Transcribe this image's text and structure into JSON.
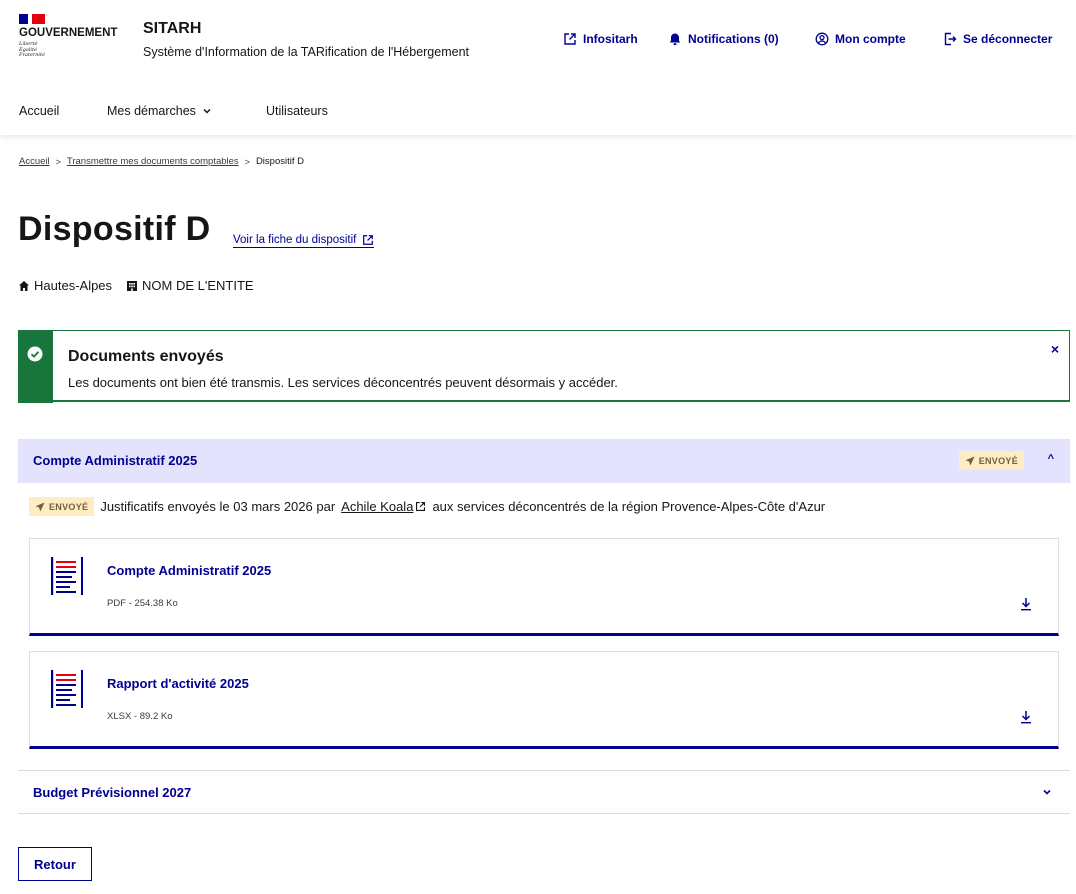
{
  "header": {
    "gov_title": "GOUVERNEMENT",
    "devise": [
      "Liberté",
      "Égalité",
      "Fraternité"
    ],
    "app_name": "SITARH",
    "app_subtitle": "Système d'Information de la TARification de l'Hébergement",
    "links": {
      "infositarh": "Infositarh",
      "notifications": "Notifications (0)",
      "account": "Mon compte",
      "logout": "Se déconnecter"
    }
  },
  "nav": {
    "home": "Accueil",
    "demarches": "Mes démarches",
    "users": "Utilisateurs"
  },
  "breadcrumb": {
    "home": "Accueil",
    "parent": "Transmettre mes documents comptables",
    "current": "Dispositif D"
  },
  "page": {
    "title": "Dispositif D",
    "fiche_link": "Voir la fiche du dispositif",
    "department": "Hautes-Alpes",
    "entity": "NOM DE L'ENTITE"
  },
  "alert": {
    "title": "Documents envoyés",
    "text": "Les documents ont bien été transmis. Les services déconcentrés peuvent désormais y accéder.",
    "close": "×"
  },
  "accordion_open": {
    "title": "Compte Administratif 2025",
    "badge": "ENVOYÉ",
    "chevron": "^",
    "sent_badge": "ENVOYÉ",
    "sent_prefix": "Justificatifs envoyés le 03 mars 2026 par",
    "sent_user": "Achile Koala",
    "sent_suffix": "aux services déconcentrés de la région Provence-Alpes-Côte d'Azur",
    "files": [
      {
        "name": "Compte Administratif 2025",
        "meta": "PDF - 254.38 Ko"
      },
      {
        "name": "Rapport d'activité 2025",
        "meta": "XLSX - 89.2 Ko"
      }
    ]
  },
  "accordion_closed": {
    "title": "Budget Prévisionnel 2027",
    "chevron": "⌄"
  },
  "buttons": {
    "retour": "Retour"
  },
  "colors": {
    "primary": "#000091",
    "success": "#18753c",
    "badge_bg": "#feecc2",
    "badge_text": "#716043",
    "accordion_open_bg": "#e3e3fd",
    "marianne_red": "#e1000f"
  }
}
